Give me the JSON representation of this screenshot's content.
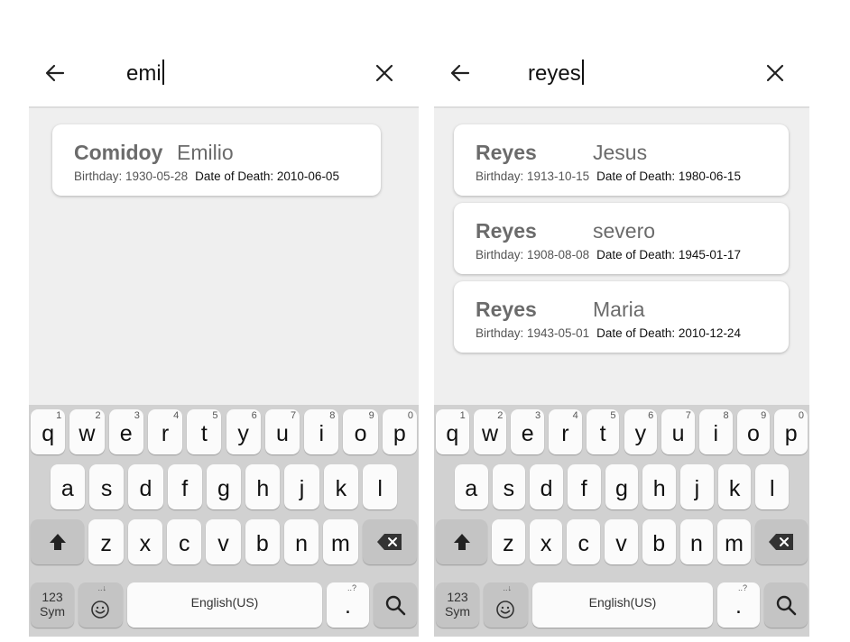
{
  "screens": [
    {
      "query": "emi",
      "results": [
        {
          "last": "Comidoy",
          "first": "Emilio",
          "birthday": "Birthday: 1930-05-28",
          "death": "Date of Death: 2010-06-05"
        }
      ]
    },
    {
      "query": "reyes",
      "results": [
        {
          "last": "Reyes",
          "first": "Jesus",
          "birthday": "Birthday: 1913-10-15",
          "death": "Date of Death: 1980-06-15"
        },
        {
          "last": "Reyes",
          "first": "severo",
          "birthday": "Birthday: 1908-08-08",
          "death": "Date of Death: 1945-01-17"
        },
        {
          "last": "Reyes",
          "first": "Maria",
          "birthday": "Birthday: 1943-05-01",
          "death": "Date of Death: 2010-12-24"
        }
      ]
    }
  ],
  "keyboard": {
    "row1": [
      {
        "ch": "q",
        "num": "1"
      },
      {
        "ch": "w",
        "num": "2"
      },
      {
        "ch": "e",
        "num": "3"
      },
      {
        "ch": "r",
        "num": "4"
      },
      {
        "ch": "t",
        "num": "5"
      },
      {
        "ch": "y",
        "num": "6"
      },
      {
        "ch": "u",
        "num": "7"
      },
      {
        "ch": "i",
        "num": "8"
      },
      {
        "ch": "o",
        "num": "9"
      },
      {
        "ch": "p",
        "num": "0"
      }
    ],
    "row2": [
      "a",
      "s",
      "d",
      "f",
      "g",
      "h",
      "j",
      "k",
      "l"
    ],
    "row3": [
      "z",
      "x",
      "c",
      "v",
      "b",
      "n",
      "m"
    ],
    "sym_label_1": "123",
    "sym_label_2": "Sym",
    "space_label": "English(US)",
    "period": ".",
    "period_hint": "..?",
    "emoji_hint": "..↓"
  },
  "icons": {
    "back": "arrow-left-icon",
    "clear": "close-icon",
    "shift": "shift-up-icon",
    "backspace": "backspace-icon",
    "emoji": "smiley-icon",
    "search": "search-icon"
  },
  "colors": {
    "results_bg": "#efefef",
    "keyboard_bg": "#d1d1d1",
    "key_bg": "#fbfbfb",
    "key_dark_bg": "#c4c4c4"
  }
}
